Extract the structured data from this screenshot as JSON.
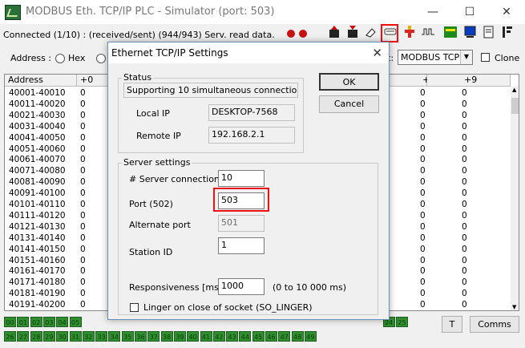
{
  "window": {
    "title": "MODBUS Eth. TCP/IP PLC - Simulator (port: 503)"
  },
  "status": {
    "text": "Connected (1/10) : (received/sent) (944/943) Serv. read data."
  },
  "address": {
    "label": "Address :",
    "hex_label": "Hex",
    "protocol_suffix": "t:",
    "protocol_value": "MODBUS TCP",
    "clone_label": "Clone"
  },
  "grid": {
    "headers": [
      "Address",
      "+0",
      "+8",
      "+9"
    ],
    "rows": [
      {
        "addr": "40001-40010",
        "v0": "0",
        "v8": "0",
        "v9": "0"
      },
      {
        "addr": "40011-40020",
        "v0": "0",
        "v8": "0",
        "v9": "0"
      },
      {
        "addr": "40021-40030",
        "v0": "0",
        "v8": "0",
        "v9": "0"
      },
      {
        "addr": "40031-40040",
        "v0": "0",
        "v8": "0",
        "v9": "0"
      },
      {
        "addr": "40041-40050",
        "v0": "0",
        "v8": "0",
        "v9": "0"
      },
      {
        "addr": "40051-40060",
        "v0": "0",
        "v8": "0",
        "v9": "0"
      },
      {
        "addr": "40061-40070",
        "v0": "0",
        "v8": "0",
        "v9": "0"
      },
      {
        "addr": "40071-40080",
        "v0": "0",
        "v8": "0",
        "v9": "0"
      },
      {
        "addr": "40081-40090",
        "v0": "0",
        "v8": "0",
        "v9": "0"
      },
      {
        "addr": "40091-40100",
        "v0": "0",
        "v8": "0",
        "v9": "0"
      },
      {
        "addr": "40101-40110",
        "v0": "0",
        "v8": "0",
        "v9": "0"
      },
      {
        "addr": "40111-40120",
        "v0": "0",
        "v8": "0",
        "v9": "0"
      },
      {
        "addr": "40121-40130",
        "v0": "0",
        "v8": "0",
        "v9": "0"
      },
      {
        "addr": "40131-40140",
        "v0": "0",
        "v8": "0",
        "v9": "0"
      },
      {
        "addr": "40141-40150",
        "v0": "0",
        "v8": "0",
        "v9": "0"
      },
      {
        "addr": "40151-40160",
        "v0": "0",
        "v8": "0",
        "v9": "0"
      },
      {
        "addr": "40161-40170",
        "v0": "0",
        "v8": "0",
        "v9": "0"
      },
      {
        "addr": "40171-40180",
        "v0": "0",
        "v8": "0",
        "v9": "0"
      },
      {
        "addr": "40181-40190",
        "v0": "0",
        "v8": "0",
        "v9": "0"
      },
      {
        "addr": "40191-40200",
        "v0": "0",
        "v8": "0",
        "v9": "0"
      }
    ]
  },
  "leds": {
    "row1": [
      "00",
      "01",
      "02",
      "03",
      "04",
      "05",
      "",
      "",
      "",
      "",
      "",
      "",
      "",
      "",
      "",
      "",
      "",
      "",
      "",
      "",
      "",
      "",
      "",
      "",
      "",
      "",
      "",
      "",
      "",
      "24",
      "25"
    ],
    "row2": [
      "26",
      "27",
      "28",
      "29",
      "30",
      "31",
      "32",
      "33",
      "34",
      "35",
      "36",
      "37",
      "38",
      "39",
      "40",
      "41",
      "42",
      "43",
      "44",
      "45",
      "46",
      "47",
      "48",
      "49"
    ]
  },
  "buttons": {
    "t": "T",
    "comms": "Comms"
  },
  "dialog": {
    "title": "Ethernet TCP/IP Settings",
    "ok": "OK",
    "cancel": "Cancel",
    "status_group": "Status",
    "status_text": "Supporting 10 simultaneous connections.",
    "local_ip_label": "Local IP",
    "local_ip_value": "DESKTOP-7568",
    "remote_ip_label": "Remote IP",
    "remote_ip_value": "192.168.2.1",
    "server_group": "Server settings",
    "server_connections_label": "# Server connections",
    "server_connections_value": "10",
    "port_label": "Port (502)",
    "port_value": "503",
    "alt_port_label": "Alternate port",
    "alt_port_value": "501",
    "station_id_label": "Station ID",
    "station_id_value": "1",
    "responsiveness_label": "Responsiveness [ms]",
    "responsiveness_value": "1000",
    "responsiveness_range": "(0 to 10 000 ms)",
    "linger_label": "Linger on close of socket (SO_LINGER)"
  },
  "colors": {
    "highlight": "#e11111",
    "led_green": "#2f8f2f",
    "status_red": "#c81010"
  }
}
